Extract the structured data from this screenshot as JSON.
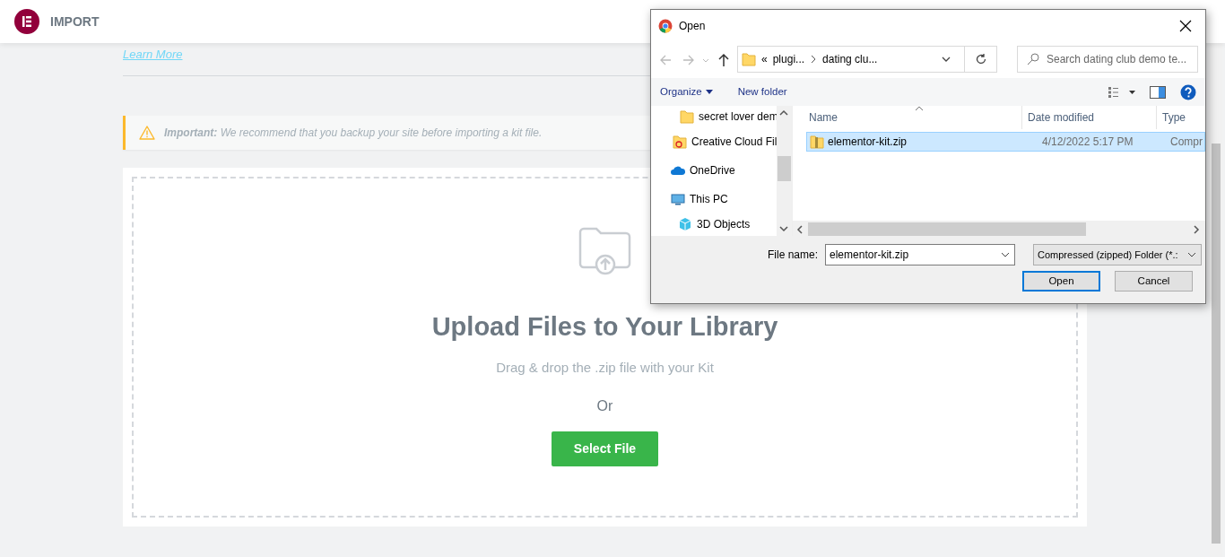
{
  "header": {
    "title": "IMPORT"
  },
  "intro": {
    "link": "Learn More"
  },
  "notice": {
    "label": "Important:",
    "text": "We recommend that you backup your site before importing a kit file."
  },
  "dropzone": {
    "title": "Upload Files to Your Library",
    "hint": "Drag & drop the .zip file with your Kit",
    "separator": "Or",
    "button": "Select File"
  },
  "dialog": {
    "title": "Open",
    "address": {
      "overflow": "«",
      "parts": [
        "plugi...",
        "dating clu..."
      ]
    },
    "search": {
      "placeholder": "Search dating club demo te..."
    },
    "toolbar": {
      "organize": "Organize",
      "new_folder": "New folder"
    },
    "nav_pane": [
      {
        "label": "secret lover dem",
        "kind": "subfolder"
      },
      {
        "label": "Creative Cloud Fil",
        "kind": "cloud"
      },
      {
        "label": "OneDrive",
        "kind": "onedrive"
      },
      {
        "label": "This PC",
        "kind": "pc",
        "children": [
          {
            "label": "3D Objects",
            "kind": "objects"
          }
        ]
      }
    ],
    "columns": [
      "Name",
      "Date modified",
      "Type"
    ],
    "files": [
      {
        "name": "elementor-kit.zip",
        "date": "4/12/2022 5:17 PM",
        "type": "Compr",
        "selected": true
      }
    ],
    "file_name_label": "File name:",
    "file_name": "elementor-kit.zip",
    "file_type": "Compressed (zipped) Folder (*.:",
    "buttons": [
      "Open",
      "Cancel"
    ]
  }
}
